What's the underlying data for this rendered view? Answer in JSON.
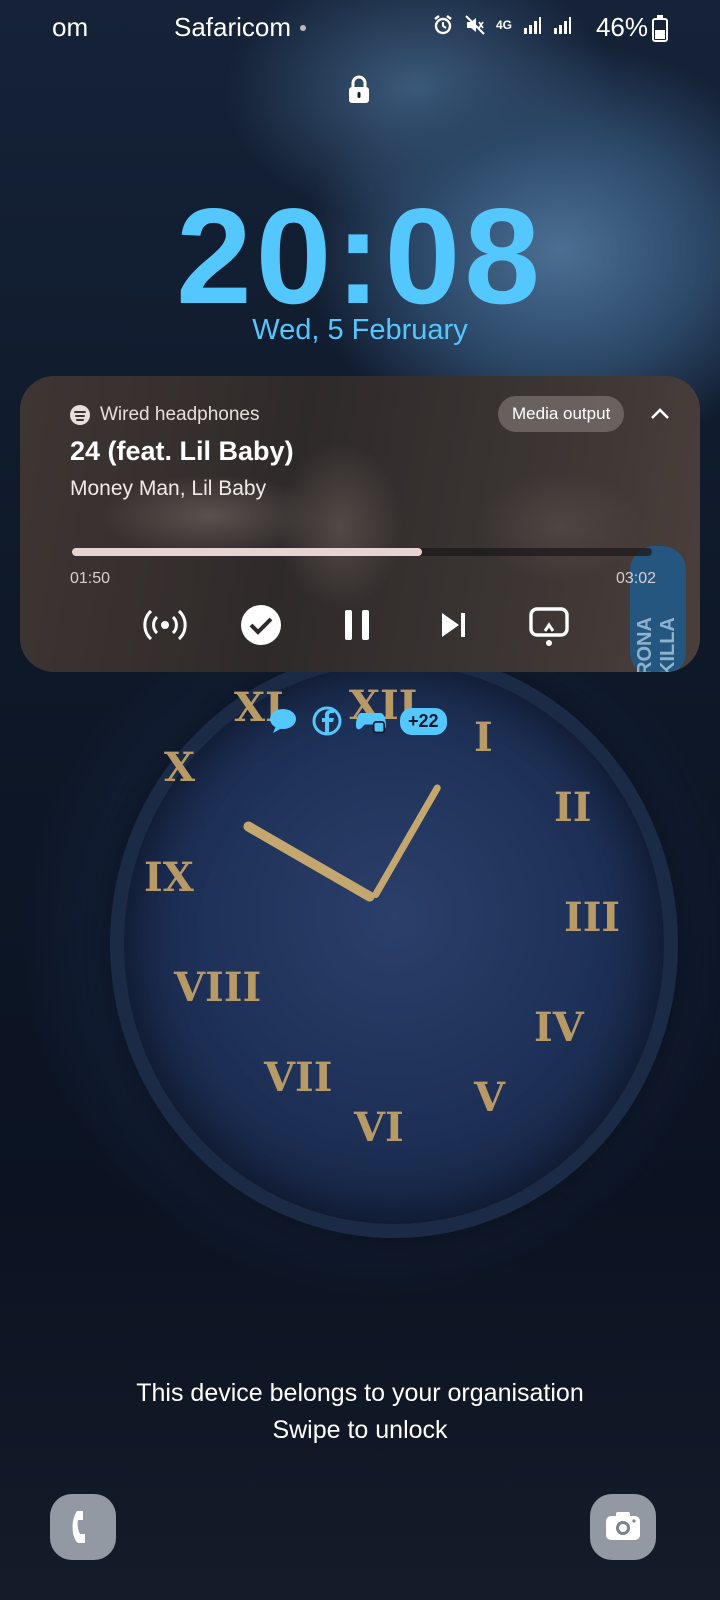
{
  "status_bar": {
    "carrier_left": "om",
    "carrier": "Safaricom",
    "network": "4G",
    "battery_percent": "46%",
    "battery_level": 0.46
  },
  "lock_screen": {
    "time": "20:08",
    "date": "Wed, 5 February",
    "time_color": "#55c7ff"
  },
  "media": {
    "source_label": "Wired headphones",
    "output_button": "Media output",
    "title": "24 (feat. Lil Baby)",
    "artist": "Money Man, Lil Baby",
    "elapsed": "01:50",
    "total": "03:02",
    "progress": 0.604,
    "album_art_text": "RONA KILLA",
    "controls": [
      "broadcast-icon",
      "check-icon",
      "pause-icon",
      "skip-next-icon",
      "cast-icon"
    ]
  },
  "notifications": {
    "icons": [
      "messages-icon",
      "facebook-icon",
      "game-controller-icon"
    ],
    "more_count": "+22"
  },
  "footer": {
    "org_notice": "This device belongs to your organisation",
    "unlock_hint": "Swipe to unlock"
  },
  "shortcuts": {
    "left": "phone-icon",
    "right": "camera-icon"
  }
}
